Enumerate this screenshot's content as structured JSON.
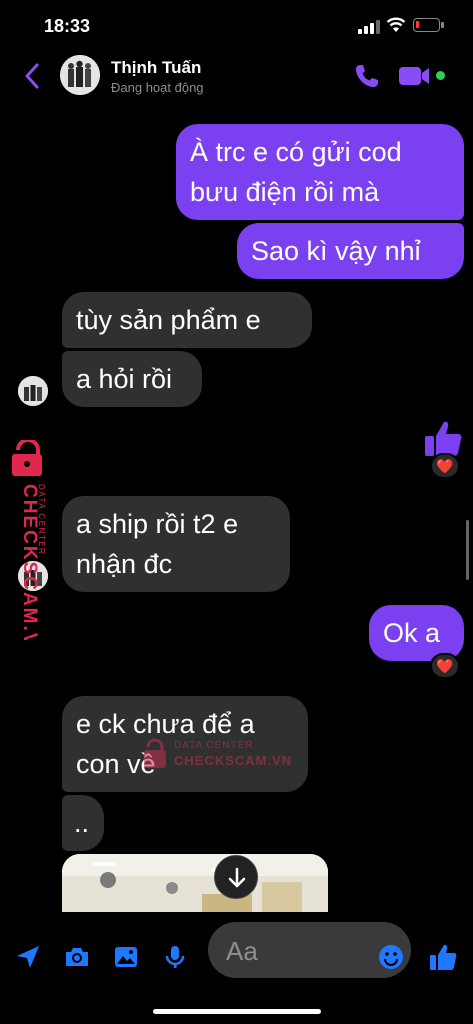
{
  "status_bar": {
    "time": "18:33"
  },
  "header": {
    "name": "Thịnh Tuấn",
    "status": "Đang hoạt động"
  },
  "messages": [
    {
      "side": "out",
      "text_line1": "À trc e có gửi cod",
      "text_line2": "bưu điện rồi mà"
    },
    {
      "side": "out",
      "text": "Sao kì vậy nhỉ"
    },
    {
      "side": "in",
      "text": "tùy sản phẩm e"
    },
    {
      "side": "in",
      "text": "a hỏi rồi"
    },
    {
      "side": "out",
      "type": "like",
      "reaction": "❤️"
    },
    {
      "side": "in",
      "text_line1": "a ship rồi t2 e",
      "text_line2": "nhận đc"
    },
    {
      "side": "out",
      "text": "Ok a",
      "reaction": "❤️"
    },
    {
      "side": "in",
      "text_line1": "e ck chưa để a",
      "text_line2": "con về"
    },
    {
      "side": "in",
      "text": ".."
    },
    {
      "side": "in",
      "type": "image"
    }
  ],
  "watermark": {
    "brand": "CHECKSCAM.VN",
    "tag": "DATA CENTER"
  },
  "composer": {
    "placeholder": "Aa"
  },
  "colors": {
    "accent": "#7b40f0",
    "incoming": "#303030",
    "online": "#31d158"
  }
}
